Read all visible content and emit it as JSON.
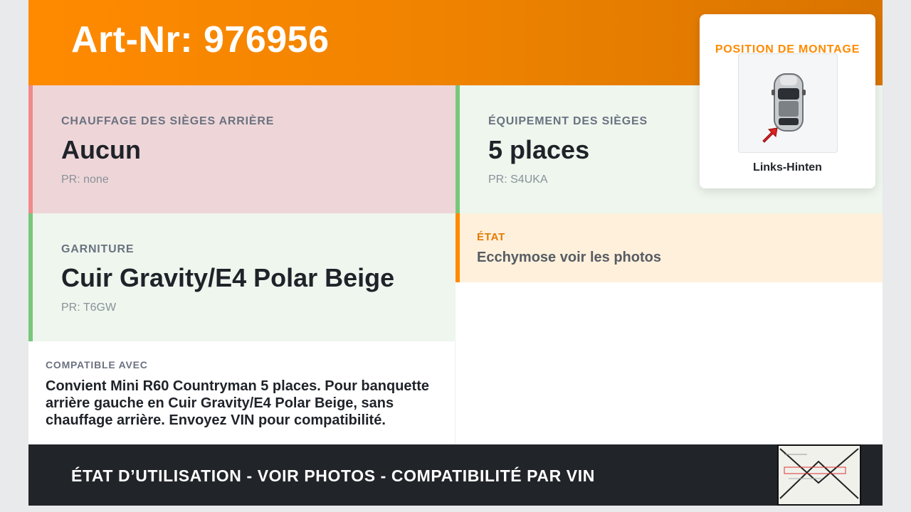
{
  "header": {
    "title": "Art-Nr: 976956"
  },
  "cells": {
    "rear_heating": {
      "label": "CHAUFFAGE DES SIÈGES ARRIÈRE",
      "value": "Aucun",
      "pr": "PR: none"
    },
    "seat_equipment": {
      "label": "ÉQUIPEMENT DES SIÈGES",
      "value": "5 places",
      "pr": "PR: S4UKA"
    },
    "upholstery": {
      "label": "GARNITURE",
      "value": "Cuir Gravity/E4 Polar Beige",
      "pr": "PR: T6GW"
    },
    "condition": {
      "label": "ÉTAT",
      "value": "Ecchymose voir les photos"
    }
  },
  "compat": {
    "label": "COMPATIBLE AVEC",
    "text": "Convient Mini R60 Countryman 5 places. Pour banquette arrière gauche en Cuir Gravity/E4 Polar Beige, sans chauffage arrière. Envoyez VIN pour compatibilité."
  },
  "position": {
    "title": "POSITION DE MONTAGE",
    "caption": "Links-Hinten",
    "icon": "car-top-view-icon"
  },
  "footer": {
    "text": "ÉTAT D’UTILISATION - VOIR PHOTOS - COMPATIBILITÉ PAR VIN"
  },
  "colors": {
    "accent": "#ff8a00",
    "negative_bg": "#eed6d8",
    "positive_bg": "#eef6ee",
    "warning_bg": "#fff0dc",
    "footer_bg": "#212428"
  }
}
